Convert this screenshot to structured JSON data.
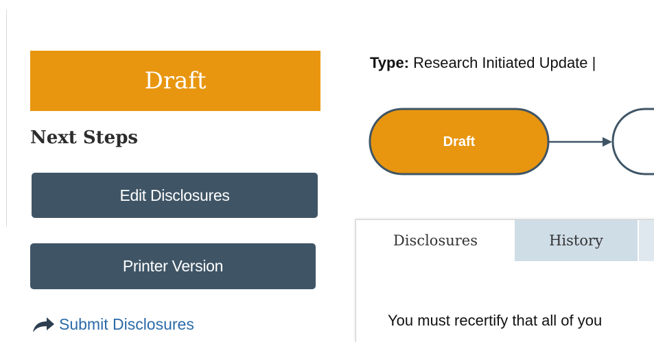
{
  "sidebar": {
    "status": "Draft",
    "next_steps_title": "Next Steps",
    "buttons": {
      "edit": "Edit Disclosures",
      "print": "Printer Version"
    },
    "submit_link": "Submit Disclosures",
    "submit_icon": "share-arrow-icon"
  },
  "header": {
    "type_label": "Type:",
    "type_value": " Research Initiated Update |"
  },
  "workflow": {
    "current_state": "Draft",
    "current_color": "#e8960f",
    "next_state": ""
  },
  "tabs": [
    {
      "label": "Disclosures",
      "active": true
    },
    {
      "label": "History",
      "active": false
    },
    {
      "label": "",
      "active": false
    }
  ],
  "panel": {
    "message": "You must recertify that all of you"
  },
  "colors": {
    "accent": "#e8960f",
    "button": "#3f5566",
    "link": "#2a6aa8",
    "tab_inactive": "#cfdde7"
  }
}
